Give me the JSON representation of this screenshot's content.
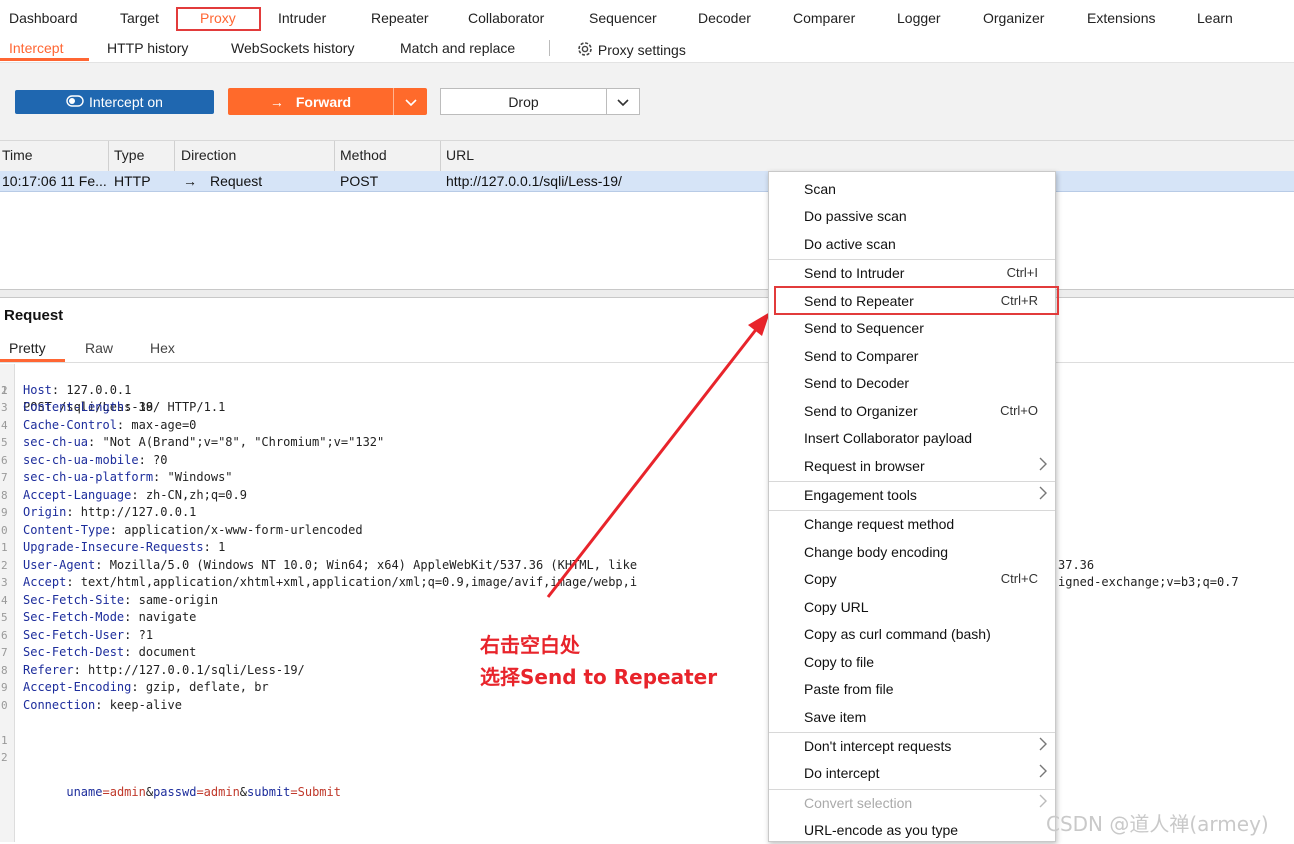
{
  "top_tabs": [
    "Dashboard",
    "Target",
    "Proxy",
    "Intruder",
    "Repeater",
    "Collaborator",
    "Sequencer",
    "Decoder",
    "Comparer",
    "Logger",
    "Organizer",
    "Extensions",
    "Learn"
  ],
  "sub_tabs": [
    "Intercept",
    "HTTP history",
    "WebSockets history",
    "Match and replace"
  ],
  "proxy_settings_label": "Proxy settings",
  "controls": {
    "intercept_label": "Intercept on",
    "forward_label": "Forward",
    "drop_label": "Drop"
  },
  "table": {
    "headers": [
      "Time",
      "Type",
      "Direction",
      "Method",
      "URL"
    ],
    "row": {
      "time": "10:17:06 11 Fe...",
      "type": "HTTP",
      "direction": "Request",
      "method": "POST",
      "url": "http://127.0.0.1/sqli/Less-19/"
    }
  },
  "request": {
    "title": "Request",
    "tabs": [
      "Pretty",
      "Raw",
      "Hex"
    ],
    "line_numbers": [
      "1",
      "2",
      "3",
      "4",
      "5",
      "6",
      "7",
      "8",
      "9",
      "0",
      "1",
      "2",
      "3",
      "4",
      "5",
      "6",
      "7",
      "8",
      "9",
      "0",
      "1",
      "2"
    ],
    "request_line": "POST /sqli/Less-19/ HTTP/1.1",
    "headers": [
      {
        "k": "Host",
        "v": ": 127.0.0.1"
      },
      {
        "k": "Content-Length",
        "v": ": 38"
      },
      {
        "k": "Cache-Control",
        "v": ": max-age=0"
      },
      {
        "k": "sec-ch-ua",
        "v": ": \"Not A(Brand\";v=\"8\", \"Chromium\";v=\"132\""
      },
      {
        "k": "sec-ch-ua-mobile",
        "v": ": ?0"
      },
      {
        "k": "sec-ch-ua-platform",
        "v": ": \"Windows\""
      },
      {
        "k": "Accept-Language",
        "v": ": zh-CN,zh;q=0.9"
      },
      {
        "k": "Origin",
        "v": ": http://127.0.0.1"
      },
      {
        "k": "Content-Type",
        "v": ": application/x-www-form-urlencoded"
      },
      {
        "k": "Upgrade-Insecure-Requests",
        "v": ": 1"
      },
      {
        "k": "User-Agent",
        "v": ": Mozilla/5.0 (Windows NT 10.0; Win64; x64) AppleWebKit/537.36 (KHTML, like"
      },
      {
        "k": "Accept",
        "v": ": text/html,application/xhtml+xml,application/xml;q=0.9,image/avif,image/webp,i"
      },
      {
        "k": "Sec-Fetch-Site",
        "v": ": same-origin"
      },
      {
        "k": "Sec-Fetch-Mode",
        "v": ": navigate"
      },
      {
        "k": "Sec-Fetch-User",
        "v": ": ?1"
      },
      {
        "k": "Sec-Fetch-Dest",
        "v": ": document"
      },
      {
        "k": "Referer",
        "v": ": http://127.0.0.1/sqli/Less-19/"
      },
      {
        "k": "Accept-Encoding",
        "v": ": gzip, deflate, br"
      },
      {
        "k": "Connection",
        "v": ": keep-alive"
      }
    ],
    "overflow_text": {
      "user_agent_tail": "37.36",
      "accept_tail": "igned-exchange;v=b3;q=0.7"
    },
    "body_params": [
      {
        "k": "uname",
        "v": "admin"
      },
      {
        "k": "passwd",
        "v": "admin"
      },
      {
        "k": "submit",
        "v": "Submit"
      }
    ]
  },
  "annotation": [
    "右击空白处",
    "选择Send to Repeater"
  ],
  "context_menu": [
    {
      "label": "Scan"
    },
    {
      "label": "Do passive scan"
    },
    {
      "label": "Do active scan"
    },
    {
      "sep": true
    },
    {
      "label": "Send to Intruder",
      "shortcut": "Ctrl+I"
    },
    {
      "label": "Send to Repeater",
      "shortcut": "Ctrl+R"
    },
    {
      "label": "Send to Sequencer"
    },
    {
      "label": "Send to Comparer"
    },
    {
      "label": "Send to Decoder"
    },
    {
      "label": "Send to Organizer",
      "shortcut": "Ctrl+O"
    },
    {
      "label": "Insert Collaborator payload"
    },
    {
      "label": "Request in browser",
      "submenu": true
    },
    {
      "sep": true
    },
    {
      "label": "Engagement tools",
      "submenu": true
    },
    {
      "sep": true
    },
    {
      "label": "Change request method"
    },
    {
      "label": "Change body encoding"
    },
    {
      "label": "Copy",
      "shortcut": "Ctrl+C"
    },
    {
      "label": "Copy URL"
    },
    {
      "label": "Copy as curl command (bash)"
    },
    {
      "label": "Copy to file"
    },
    {
      "label": "Paste from file"
    },
    {
      "label": "Save item"
    },
    {
      "sep": true
    },
    {
      "label": "Don't intercept requests",
      "submenu": true
    },
    {
      "label": "Do intercept",
      "submenu": true
    },
    {
      "sep": true
    },
    {
      "label": "Convert selection",
      "submenu": true,
      "disabled": true
    },
    {
      "label": "URL-encode as you type"
    }
  ],
  "watermark": "CSDN @道人禅(armey)",
  "colors": {
    "accent_orange": "#ff6a2b",
    "intercept_blue": "#1f67b0",
    "highlight_red": "#e23b3b",
    "annotation_red": "#e8242b",
    "selected_row": "#d6e4f7"
  }
}
